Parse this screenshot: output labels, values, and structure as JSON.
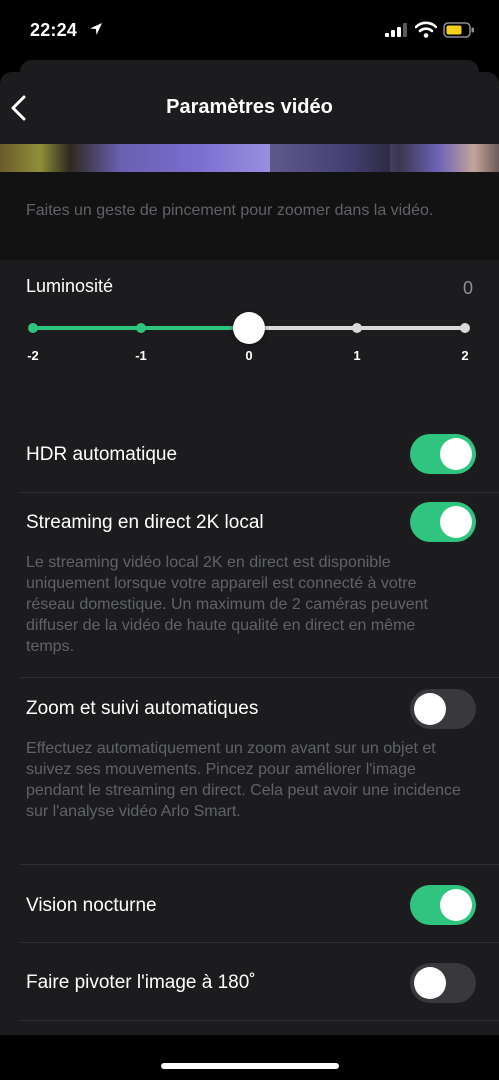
{
  "status_bar": {
    "time": "22:24",
    "icons": [
      "location-arrow-icon",
      "signal-icon",
      "wifi-icon",
      "battery-icon"
    ],
    "battery_color": "#f5d01f"
  },
  "nav": {
    "back_icon": "chevron-left-icon",
    "title": "Paramètres vidéo"
  },
  "video_hint": "Faites un geste de pincement pour zoomer dans la vidéo.",
  "brightness": {
    "label": "Luminosité",
    "value": "0",
    "ticks": [
      "-2",
      "-1",
      "0",
      "1",
      "2"
    ],
    "min": -2,
    "max": 2,
    "current": 0
  },
  "settings": {
    "hdr": {
      "label": "HDR automatique",
      "enabled": true
    },
    "streaming_2k": {
      "label": "Streaming en direct 2K local",
      "enabled": true,
      "description": "Le streaming vidéo local 2K en direct est disponible uniquement lorsque votre appareil est connecté à votre réseau domestique. Un maximum de 2 caméras peuvent diffuser de la vidéo de haute qualité en direct en même temps."
    },
    "auto_zoom": {
      "label": "Zoom et suivi automatiques",
      "enabled": false,
      "description": "Effectuez automatiquement un zoom avant sur un objet et suivez ses mouvements. Pincez pour améliorer l'image pendant le streaming en direct. Cela peut avoir une incidence sur l'analyse vidéo Arlo Smart."
    },
    "night_vision": {
      "label": "Vision nocturne",
      "enabled": true
    },
    "rotate": {
      "label": "Faire pivoter l'image à 180˚",
      "enabled": false
    }
  },
  "colors": {
    "accent": "#2fc47f",
    "background": "#1c1c1e",
    "secondary_text": "#5f6368"
  }
}
